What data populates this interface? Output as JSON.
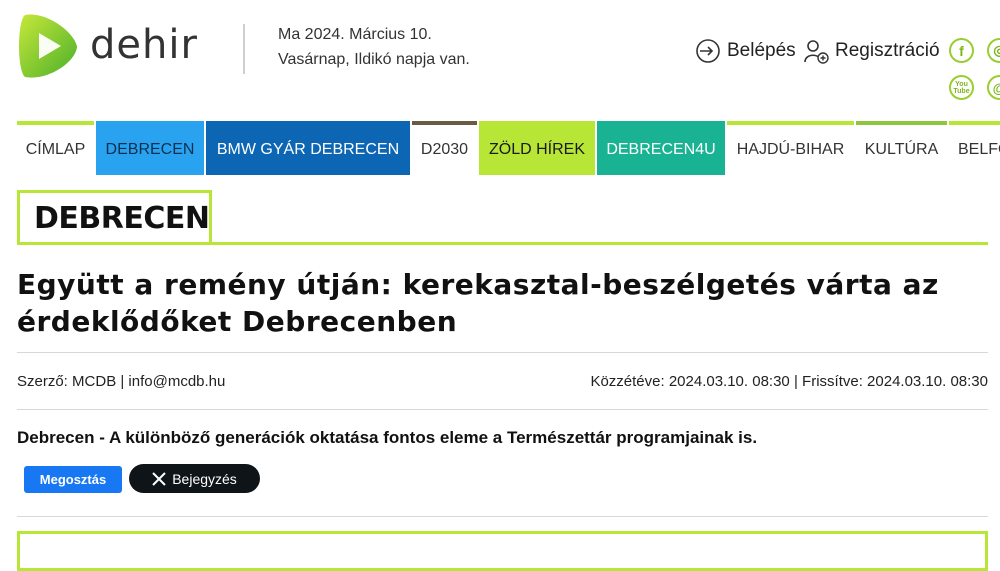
{
  "site": {
    "logo_text": "dehir",
    "brand_color": "#8dc63f",
    "accent_color": "#b8e636"
  },
  "header": {
    "date_line": "Ma 2024. Március 10.",
    "nameday_line": "Vasárnap, Ildikó napja van.",
    "login_label": "Belépés",
    "register_label": "Regisztráció",
    "login_icon": "login-icon",
    "register_icon": "user-add-icon"
  },
  "social": [
    {
      "name": "facebook-icon",
      "glyph": "f"
    },
    {
      "name": "instagram-icon",
      "glyph": "◎"
    },
    {
      "name": "youtube-icon",
      "glyph": "You\nTube"
    },
    {
      "name": "at-icon",
      "glyph": "@"
    }
  ],
  "nav": {
    "items": [
      {
        "label": "CÍMLAP",
        "bg": "#ffffff",
        "fg": "#333333",
        "border": "#b8e636"
      },
      {
        "label": "DEBRECEN",
        "bg": "#29a3f0",
        "fg": "#0d2f4f",
        "border": "#29a3f0"
      },
      {
        "label": "BMW GYÁR DEBRECEN",
        "bg": "#0d66b3",
        "fg": "#ffffff",
        "border": "#0d66b3"
      },
      {
        "label": "D2030",
        "bg": "#ffffff",
        "fg": "#333333",
        "border": "#6b5a44"
      },
      {
        "label": "ZÖLD HÍREK",
        "bg": "#b8e636",
        "fg": "#1a1a1a",
        "border": "#b8e636"
      },
      {
        "label": "DEBRECEN4U",
        "bg": "#19b394",
        "fg": "#ffffff",
        "border": "#19b394"
      },
      {
        "label": "HAJDÚ-BIHAR",
        "bg": "#ffffff",
        "fg": "#333333",
        "border": "#b8e636"
      },
      {
        "label": "KULTÚRA",
        "bg": "#ffffff",
        "fg": "#333333",
        "border": "#8dc63f"
      },
      {
        "label": "BELFÖLD",
        "bg": "#ffffff",
        "fg": "#333333",
        "border": "#b8e636"
      }
    ]
  },
  "section": {
    "title": "DEBRECEN"
  },
  "article": {
    "title_line1": "Együtt a remény útján: kerekasztal-beszélgetés várta az",
    "title_line2": "érdeklődőket Debrecenben",
    "author_prefix": "Szerző:",
    "author": "MCDB | info@mcdb.hu",
    "published_label": "Közzétéve:",
    "published": "2024.03.10. 08:30",
    "updated_label": "Frissítve:",
    "updated": "2024.03.10. 08:30",
    "lead": "Debrecen - A különböző generációk oktatása fontos eleme a Természettár programjainak is."
  },
  "share": {
    "facebook_label": "Megosztás",
    "x_label": "Bejegyzés",
    "x_icon": "x-logo-icon"
  }
}
